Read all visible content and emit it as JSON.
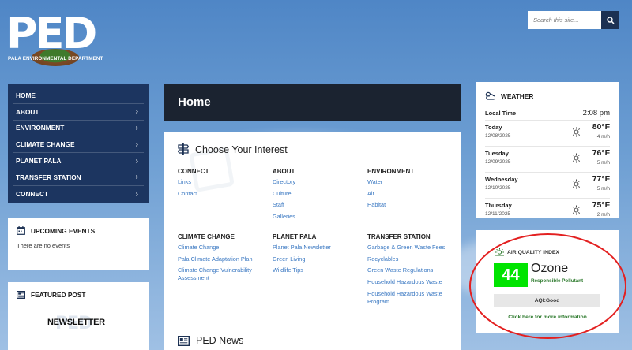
{
  "logo": {
    "text": "PED",
    "subtitle": "PALA ENVIRONMENTAL DEPARTMENT"
  },
  "search": {
    "placeholder": "Search this site..."
  },
  "nav": {
    "items": [
      {
        "label": "HOME"
      },
      {
        "label": "ABOUT"
      },
      {
        "label": "ENVIRONMENT"
      },
      {
        "label": "CLIMATE CHANGE"
      },
      {
        "label": "PLANET PALA"
      },
      {
        "label": "TRANSFER STATION"
      },
      {
        "label": "CONNECT"
      }
    ]
  },
  "upcoming_events": {
    "title": "UPCOMING EVENTS",
    "empty_text": "There are no events"
  },
  "featured_post": {
    "title": "FEATURED POST",
    "image_text": "NEWSLETTER"
  },
  "page": {
    "title": "Home"
  },
  "interest": {
    "title": "Choose Your Interest",
    "columns": [
      {
        "heading": "CONNECT",
        "links": [
          "Links",
          "Contact"
        ]
      },
      {
        "heading": "ABOUT",
        "links": [
          "Directory",
          "Culture",
          "Staff",
          "Galleries"
        ]
      },
      {
        "heading": "ENVIRONMENT",
        "links": [
          "Water",
          "Air",
          "Habitat"
        ]
      },
      {
        "heading": "CLIMATE CHANGE",
        "links": [
          "Climate Change",
          "Pala Climate Adaptation Plan",
          "Climate Change Vulnerability Assessment"
        ]
      },
      {
        "heading": "PLANET PALA",
        "links": [
          "Planet Pala Newsletter",
          "Green Living",
          "Wildlife Tips"
        ]
      },
      {
        "heading": "TRANSFER STATION",
        "links": [
          "Garbage & Green Waste Fees",
          "Recyclables",
          "Green Waste Regulations",
          "Household Hazardous Waste",
          "Household Hazardous Waste Program"
        ]
      }
    ]
  },
  "news": {
    "title": "PED News"
  },
  "weather": {
    "title": "WEATHER",
    "local_time_label": "Local Time",
    "local_time": "2:08 pm",
    "days": [
      {
        "day": "Today",
        "date": "12/08/2025",
        "temp": "80°F",
        "wind": "4 m/h"
      },
      {
        "day": "Tuesday",
        "date": "12/09/2025",
        "temp": "76°F",
        "wind": "5 m/h"
      },
      {
        "day": "Wednesday",
        "date": "12/10/2025",
        "temp": "77°F",
        "wind": "5 m/h"
      },
      {
        "day": "Thursday",
        "date": "12/11/2025",
        "temp": "75°F",
        "wind": "2 m/h"
      }
    ]
  },
  "aqi": {
    "title": "AIR QUALITY INDEX",
    "value": "44",
    "pollutant": "Ozone",
    "pollutant_label": "Responsible Pollutant",
    "status": "AQI:Good",
    "link": "Click here for more information",
    "color": "#00e400"
  },
  "colors": {
    "nav_bg": "#1c3560",
    "header_bg": "#1b2330",
    "link": "#3a78c2",
    "annotation_ring": "#e32020"
  }
}
